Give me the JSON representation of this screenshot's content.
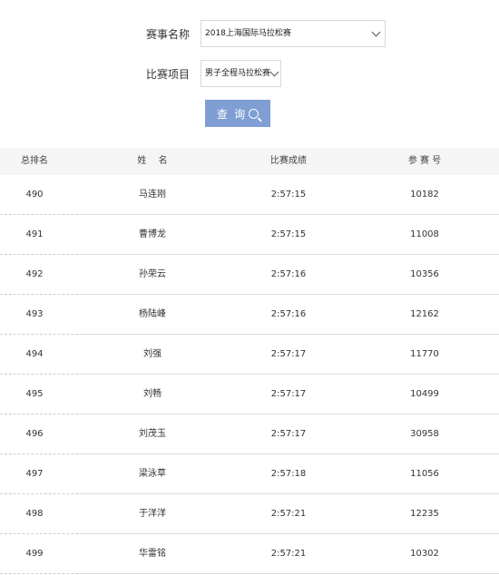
{
  "form": {
    "event_label": "赛事名称",
    "event_value": "2018上海国际马拉松赛",
    "category_label": "比赛项目",
    "category_value": "男子全程马拉松赛",
    "search_label": "查 询"
  },
  "table": {
    "headers": [
      "总排名",
      "姓　 名",
      "比赛成绩",
      "参 赛 号"
    ],
    "rows": [
      {
        "rank": "490",
        "name": "马连刚",
        "time": "2:57:15",
        "bib": "10182"
      },
      {
        "rank": "491",
        "name": "曹博龙",
        "time": "2:57:15",
        "bib": "11008"
      },
      {
        "rank": "492",
        "name": "孙荣云",
        "time": "2:57:16",
        "bib": "10356"
      },
      {
        "rank": "493",
        "name": "杨陆峰",
        "time": "2:57:16",
        "bib": "12162"
      },
      {
        "rank": "494",
        "name": "刘强",
        "time": "2:57:17",
        "bib": "11770"
      },
      {
        "rank": "495",
        "name": "刘畅",
        "time": "2:57:17",
        "bib": "10499"
      },
      {
        "rank": "496",
        "name": "刘茂玉",
        "time": "2:57:17",
        "bib": "30958"
      },
      {
        "rank": "497",
        "name": "梁泳草",
        "time": "2:57:18",
        "bib": "11056"
      },
      {
        "rank": "498",
        "name": "于洋洋",
        "time": "2:57:21",
        "bib": "12235"
      },
      {
        "rank": "499",
        "name": "华雷铭",
        "time": "2:57:21",
        "bib": "10302"
      }
    ]
  },
  "colors": {
    "button": "#7f9ed3",
    "header_bg": "#f5f5f5",
    "divider": "#dcdcdc"
  }
}
